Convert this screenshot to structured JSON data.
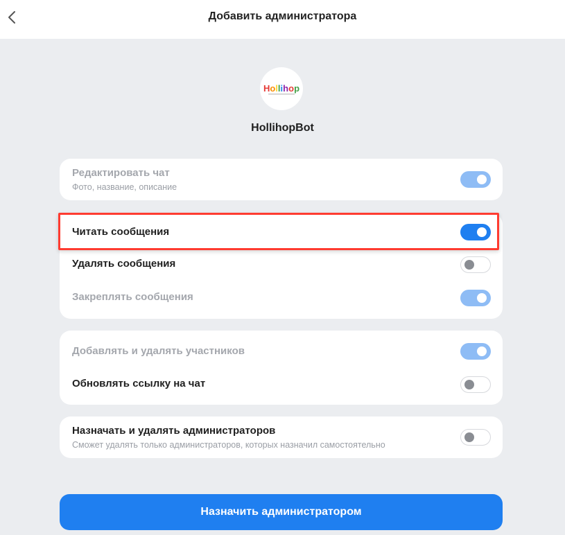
{
  "header": {
    "title": "Добавить администратора",
    "back_icon": "chevron-left-icon"
  },
  "bot": {
    "name": "HollihopBot",
    "logo_text": "Hollihop"
  },
  "groups": [
    {
      "items": [
        {
          "title": "Редактировать чат",
          "subtitle": "Фото, название, описание",
          "state": "on-disabled",
          "enabled": false
        }
      ]
    },
    {
      "items": [
        {
          "title": "Читать сообщения",
          "state": "on",
          "enabled": true
        },
        {
          "title": "Удалять сообщения",
          "state": "off",
          "enabled": true
        },
        {
          "title": "Закреплять сообщения",
          "state": "on-disabled",
          "enabled": false
        }
      ]
    },
    {
      "items": [
        {
          "title": "Добавлять и удалять участников",
          "state": "on-disabled",
          "enabled": false
        },
        {
          "title": "Обновлять ссылку на чат",
          "state": "off",
          "enabled": true
        }
      ]
    },
    {
      "items": [
        {
          "title": "Назначать и удалять администраторов",
          "subtitle": "Сможет удалять только администраторов, которых назначил самостоятельно",
          "state": "off",
          "enabled": true
        }
      ]
    }
  ],
  "primary_button": {
    "label": "Назначить администратором"
  },
  "colors": {
    "accent": "#1f7ff0",
    "accent_disabled": "#8ebcf5",
    "highlight": "#ff3b30",
    "background": "#ebedf0"
  }
}
